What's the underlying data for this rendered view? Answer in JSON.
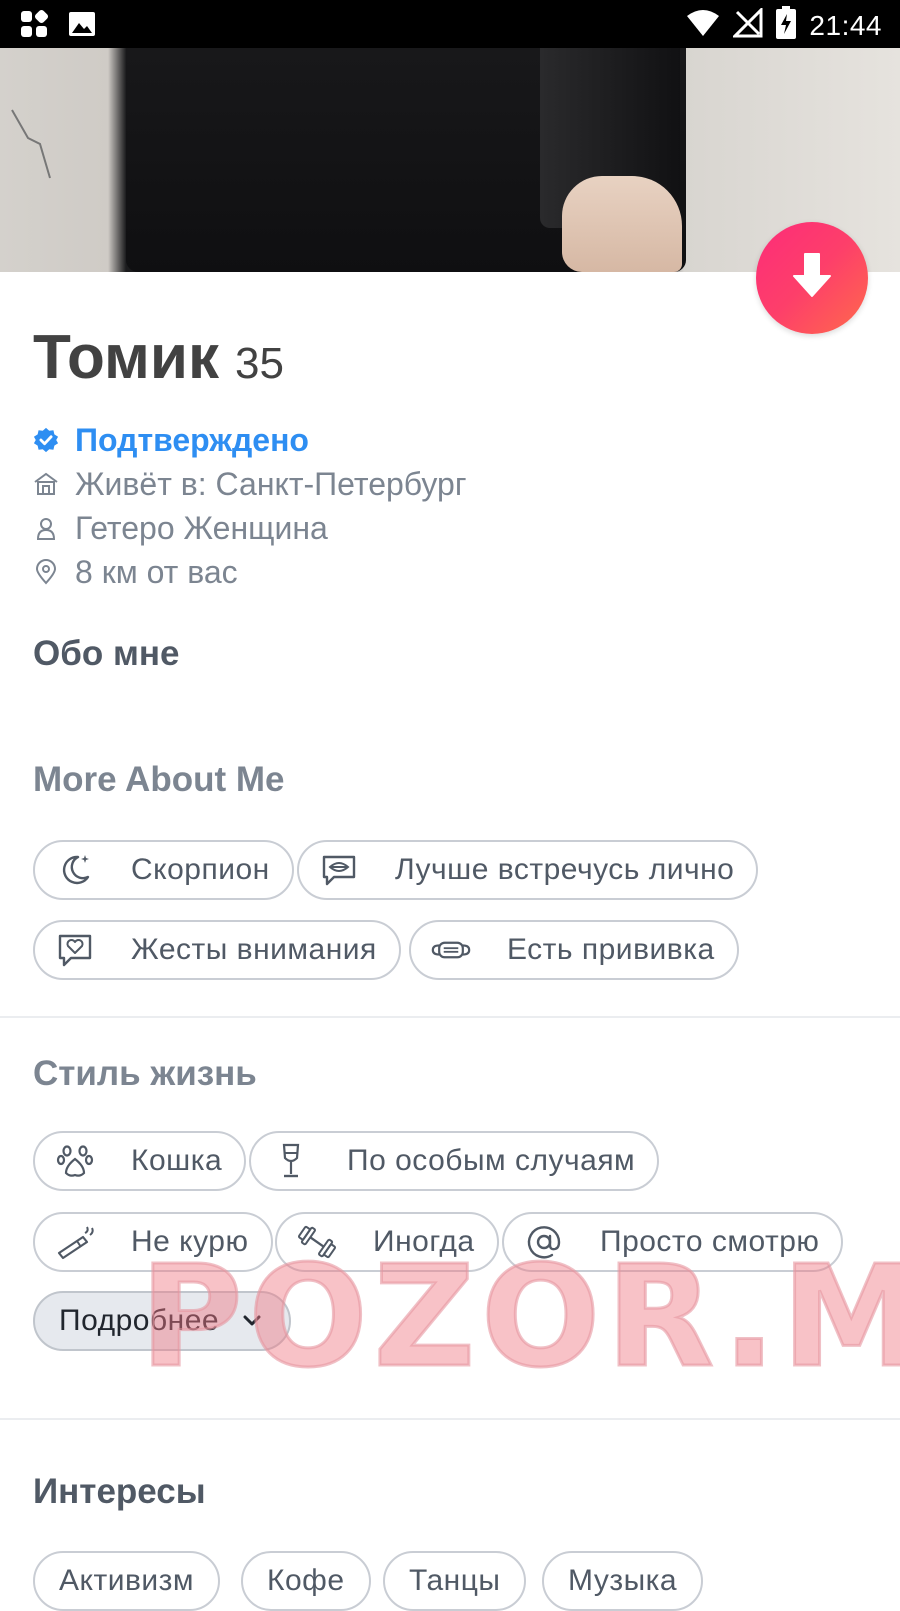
{
  "status_bar": {
    "time": "21:44"
  },
  "profile": {
    "name": "Томик",
    "age": "35",
    "verified_label": "Подтверждено",
    "lives_in": "Живёт в: Санкт-Петербург",
    "orientation_gender": "Гетеро Женщина",
    "distance": "8 км от вас"
  },
  "sections": {
    "about_title": "Обо мне",
    "more_about_title": "More About Me",
    "lifestyle_title": "Стиль жизнь",
    "interests_title": "Интересы"
  },
  "more_about": [
    {
      "label": "Скорпион",
      "icon": "moon-stars-icon"
    },
    {
      "label": "Лучше встречусь лично",
      "icon": "chat-bubble-icon"
    },
    {
      "label": "Жесты внимания",
      "icon": "heart-bubble-icon"
    },
    {
      "label": "Есть прививка",
      "icon": "face-mask-icon"
    }
  ],
  "lifestyle": [
    {
      "label": "Кошка",
      "icon": "paw-icon"
    },
    {
      "label": "По особым случаям",
      "icon": "wine-glass-icon"
    },
    {
      "label": "Не курю",
      "icon": "cigarette-icon"
    },
    {
      "label": "Иногда",
      "icon": "dumbbell-icon"
    },
    {
      "label": "Просто смотрю",
      "icon": "at-sign-icon"
    }
  ],
  "more_button_label": "Подробнее",
  "interests": [
    "Активизм",
    "Кофе",
    "Танцы",
    "Музыка"
  ],
  "watermark": "POZOR.ME",
  "colors": {
    "accent": "#fd3f6a",
    "verified": "#2e8ef2",
    "text": "#505965"
  }
}
